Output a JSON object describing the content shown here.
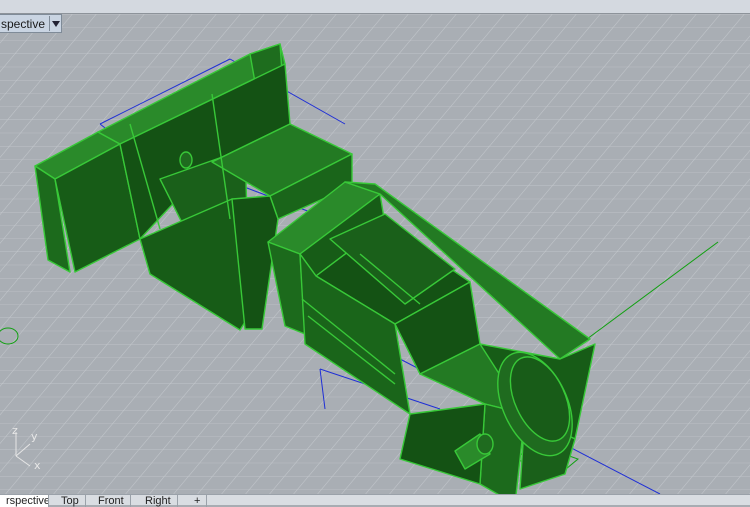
{
  "viewport": {
    "title": "spective",
    "menu_icon": "chevron-down-icon"
  },
  "axes": {
    "z": "z",
    "y": "y",
    "x": "x"
  },
  "tabs": [
    {
      "label": "rspective",
      "active": true
    },
    {
      "label": "Top",
      "active": false
    },
    {
      "label": "Front",
      "active": false
    },
    {
      "label": "Right",
      "active": false
    },
    {
      "label": "+",
      "active": false
    }
  ],
  "colors": {
    "background": "#a9aeb4",
    "grid": "#c3c7cc",
    "model_fill": "#1f6b1f",
    "model_edge": "#38c838",
    "selection_line": "#1f2fd6",
    "gumball_green": "#12a012"
  }
}
